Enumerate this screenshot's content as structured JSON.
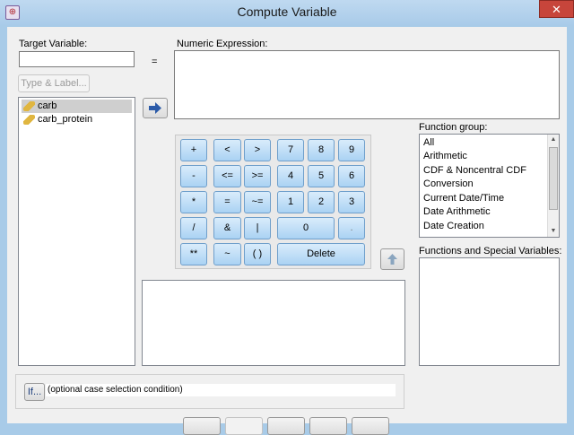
{
  "window": {
    "title": "Compute Variable",
    "close_glyph": "✕",
    "app_icon": "spss-icon"
  },
  "target": {
    "label": "Target Variable:",
    "value": ""
  },
  "equals": "=",
  "type_label_button": "Type & Label...",
  "expression": {
    "label": "Numeric Expression:",
    "value": ""
  },
  "variables": [
    {
      "name": "carb",
      "selected": true
    },
    {
      "name": "carb_protein",
      "selected": false
    }
  ],
  "keypad": {
    "keys": [
      "+",
      "<",
      ">",
      "7",
      "8",
      "9",
      "-",
      "<=",
      ">=",
      "4",
      "5",
      "6",
      "*",
      "=",
      "~=",
      "1",
      "2",
      "3",
      "/",
      "&",
      "|",
      "0",
      ".",
      "**",
      "~",
      "( )",
      "Delete"
    ]
  },
  "function_group": {
    "label": "Function group:",
    "items": [
      "All",
      "Arithmetic",
      "CDF & Noncentral CDF",
      "Conversion",
      "Current Date/Time",
      "Date Arithmetic",
      "Date Creation"
    ]
  },
  "functions_label": "Functions and Special Variables:",
  "if_button": "If...",
  "if_condition": "(optional case selection condition)"
}
